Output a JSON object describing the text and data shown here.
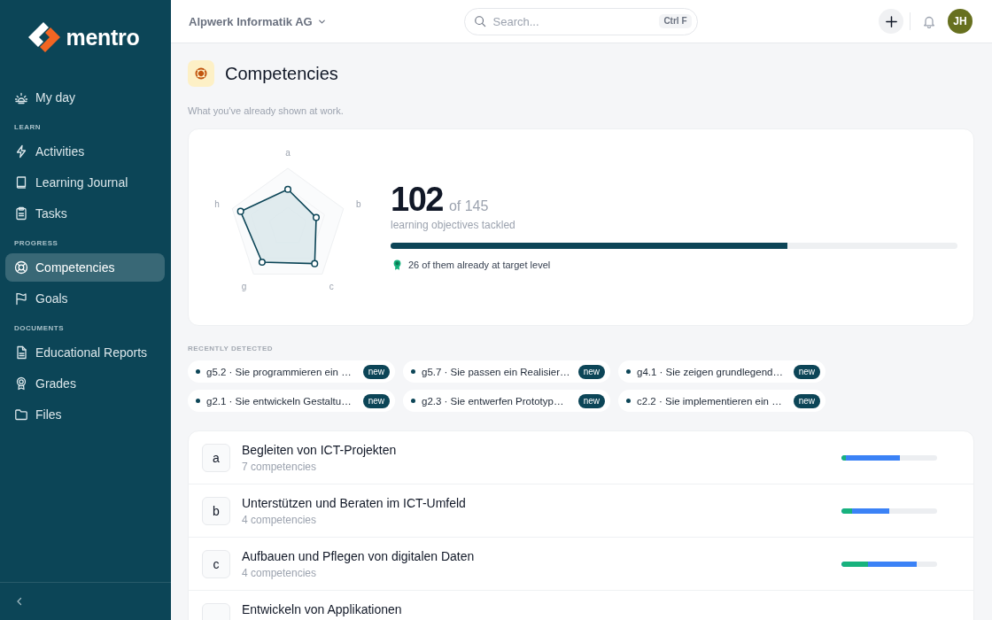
{
  "sidebar": {
    "logo": "mentro",
    "sections": [
      {
        "items": [
          {
            "label": "My day",
            "selected": false
          }
        ]
      },
      {
        "heading": "LEARN",
        "items": [
          {
            "label": "Activities",
            "selected": false
          },
          {
            "label": "Learning Journal",
            "selected": false
          },
          {
            "label": "Tasks",
            "selected": false
          }
        ]
      },
      {
        "heading": "PROGRESS",
        "items": [
          {
            "label": "Competencies",
            "selected": true
          },
          {
            "label": "Goals",
            "selected": false
          }
        ]
      },
      {
        "heading": "DOCUMENTS",
        "items": [
          {
            "label": "Educational Reports",
            "selected": false
          },
          {
            "label": "Grades",
            "selected": false
          },
          {
            "label": "Files",
            "selected": false
          }
        ]
      }
    ]
  },
  "header": {
    "organization": "Alpwerk Informatik AG",
    "search": {
      "placeholder": "Search...",
      "shortcut": "Ctrl F"
    },
    "avatar": "JH"
  },
  "page": {
    "title": "Competencies",
    "subtitle": "What you've already shown at work."
  },
  "summary": {
    "radar": {
      "axes": [
        "a",
        "b",
        "c",
        "g",
        "h"
      ]
    },
    "count": "102",
    "total": "of 145",
    "caption": "learning objectives tackled",
    "progress": {
      "level": 0.7
    },
    "note": "26 of them already at target level"
  },
  "recently_detected": {
    "heading": "RECENTLY DETECTED",
    "items": [
      {
        "text": "g5.2 · Sie programmieren ein …",
        "badge": "new"
      },
      {
        "text": "g5.7 · Sie passen ein Realisier…",
        "badge": "new"
      },
      {
        "text": "g4.1 · Sie zeigen grundlegend…",
        "badge": "new"
      },
      {
        "text": "g2.1 · Sie entwickeln Gestaltu…",
        "badge": "new"
      },
      {
        "text": "g2.3 · Sie entwerfen Prototyp…",
        "badge": "new"
      },
      {
        "text": "c2.2 · Sie implementieren ein …",
        "badge": "new"
      }
    ]
  },
  "areas": [
    {
      "letter": "a",
      "title": "Begleiten von ICT-Projekten",
      "subtitle": "7 competencies",
      "segments": [
        {
          "kind": "at_target",
          "level": 0.05
        },
        {
          "kind": "tackled",
          "level": 0.61
        }
      ]
    },
    {
      "letter": "b",
      "title": "Unterstützen und Beraten im ICT-Umfeld",
      "subtitle": "4 competencies",
      "segments": [
        {
          "kind": "at_target",
          "level": 0.11
        },
        {
          "kind": "tackled",
          "level": 0.5
        }
      ]
    },
    {
      "letter": "c",
      "title": "Aufbauen und Pflegen von digitalen Daten",
      "subtitle": "4 competencies",
      "segments": [
        {
          "kind": "at_target",
          "level": 0.28
        },
        {
          "kind": "tackled",
          "level": 0.79
        }
      ]
    },
    {
      "title": "Entwickeln von Applikationen"
    }
  ]
}
